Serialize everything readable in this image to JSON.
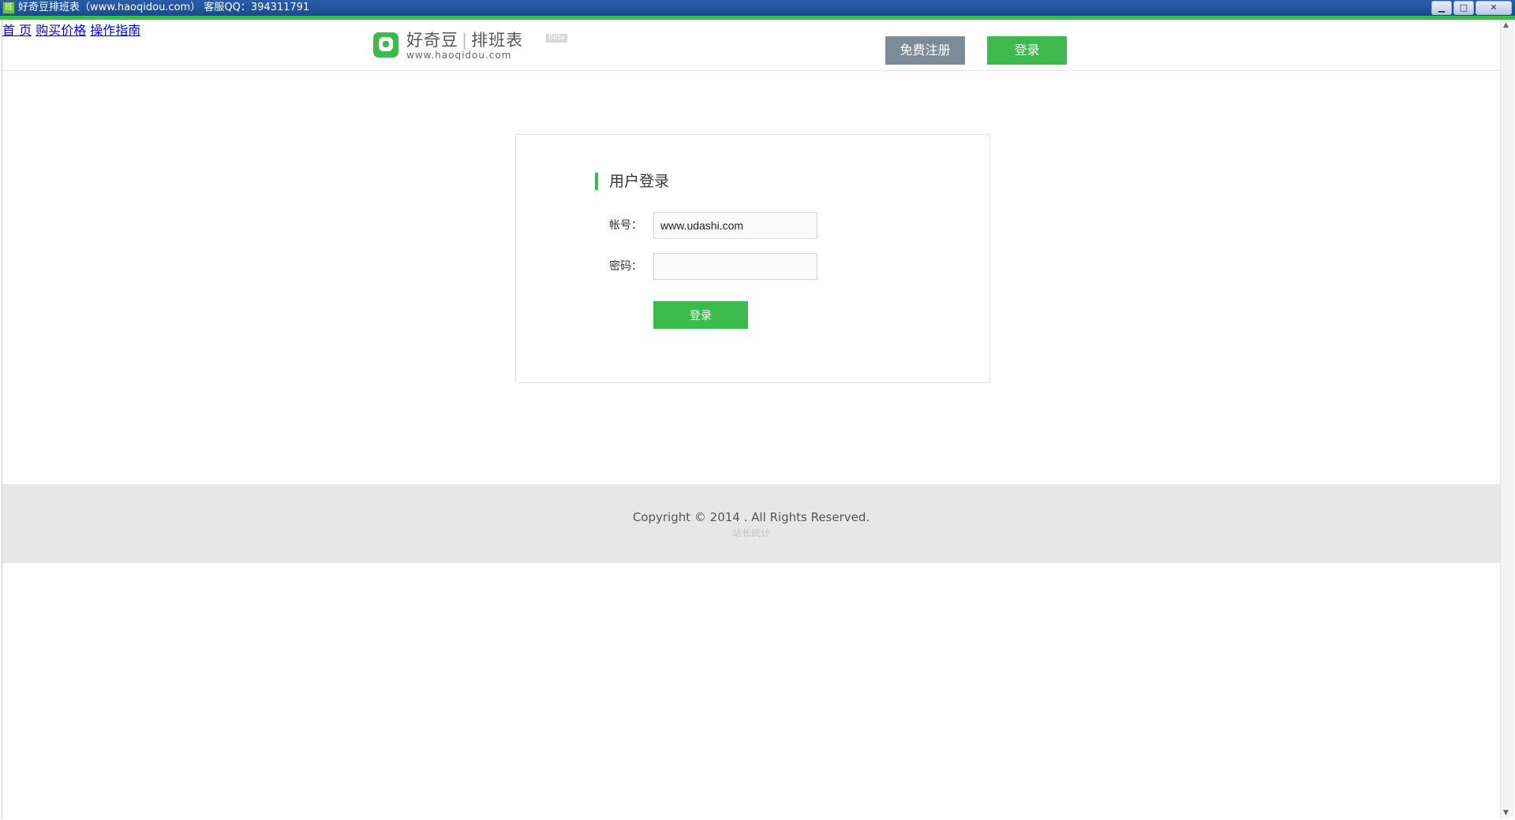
{
  "window": {
    "title": "好奇豆排班表（www.haoqidou.com） 客服QQ：394311791",
    "app_icon_glyph": "班",
    "controls": {
      "minimize": "▁",
      "maximize": "□",
      "close": "✕"
    }
  },
  "header": {
    "logo": {
      "brand": "好奇豆",
      "product": "排班表",
      "separator": "|",
      "url": "www.haoqidou.com",
      "badge": "Beta",
      "icon": "haoqidou-logo-icon"
    },
    "nav": [
      "首 页",
      "购买价格",
      "操作指南"
    ],
    "register_label": "免费注册",
    "login_label": "登录"
  },
  "login": {
    "title": "用户登录",
    "account_label": "帐号：",
    "account_value": "www.udashi.com",
    "password_label": "密码：",
    "password_value": "",
    "submit_label": "登录"
  },
  "footer": {
    "copyright": "Copyright © 2014 . All Rights Reserved.",
    "stats_link": "站长统计"
  },
  "colors": {
    "accent_green": "#3dba4e",
    "register_gray": "#7d8a97",
    "footer_bg": "#e7e7e7"
  }
}
